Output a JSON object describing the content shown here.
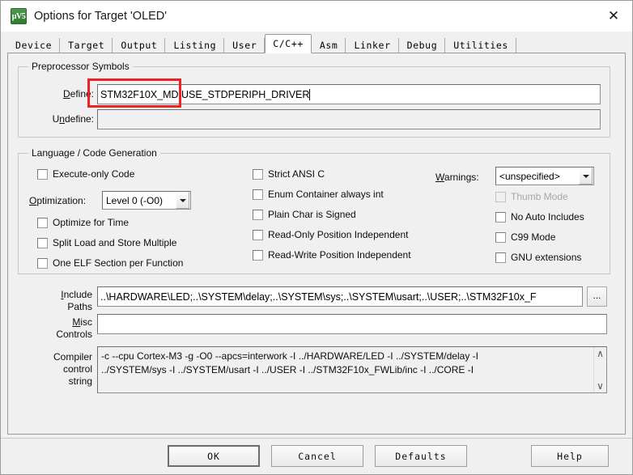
{
  "window": {
    "title": "Options for Target 'OLED'",
    "icon_name": "keil-uvision-icon",
    "icon_glyph": "µV5",
    "close_label": "✕"
  },
  "tabs": [
    {
      "label": "Device",
      "active": false
    },
    {
      "label": "Target",
      "active": false
    },
    {
      "label": "Output",
      "active": false
    },
    {
      "label": "Listing",
      "active": false
    },
    {
      "label": "User",
      "active": false
    },
    {
      "label": "C/C++",
      "active": true
    },
    {
      "label": "Asm",
      "active": false
    },
    {
      "label": "Linker",
      "active": false
    },
    {
      "label": "Debug",
      "active": false
    },
    {
      "label": "Utilities",
      "active": false
    }
  ],
  "preprocessor": {
    "group_title": "Preprocessor Symbols",
    "define_label": "Define:",
    "define_value": "STM32F10X_MD,USE_STDPERIPH_DRIVER",
    "undefine_label": "Undefine:",
    "undefine_value": ""
  },
  "language": {
    "group_title": "Language / Code Generation",
    "col1": [
      {
        "label": "Execute-only Code",
        "checked": false,
        "disabled": false
      },
      {
        "label": "Optimize for Time",
        "checked": false,
        "disabled": false
      },
      {
        "label": "Split Load and Store Multiple",
        "checked": false,
        "disabled": false
      },
      {
        "label": "One ELF Section per Function",
        "checked": false,
        "disabled": false
      }
    ],
    "col2": [
      {
        "label": "Strict ANSI C",
        "checked": false,
        "disabled": false
      },
      {
        "label": "Enum Container always int",
        "checked": false,
        "disabled": false
      },
      {
        "label": "Plain Char is Signed",
        "checked": false,
        "disabled": false
      },
      {
        "label": "Read-Only Position Independent",
        "checked": false,
        "disabled": false
      },
      {
        "label": "Read-Write Position Independent",
        "checked": false,
        "disabled": false
      }
    ],
    "col3": [
      {
        "label": "Thumb Mode",
        "checked": false,
        "disabled": true
      },
      {
        "label": "No Auto Includes",
        "checked": false,
        "disabled": false
      },
      {
        "label": "C99 Mode",
        "checked": false,
        "disabled": false
      },
      {
        "label": "GNU extensions",
        "checked": false,
        "disabled": false
      }
    ],
    "optimization_label": "Optimization:",
    "optimization_value": "Level 0 (-O0)",
    "warnings_label": "Warnings:",
    "warnings_value": "<unspecified>"
  },
  "paths": {
    "include_label_line1": "Include",
    "include_label_line2": "Paths",
    "include_value": "..\\HARDWARE\\LED;..\\SYSTEM\\delay;..\\SYSTEM\\sys;..\\SYSTEM\\usart;..\\USER;..\\STM32F10x_F",
    "browse_label": "...",
    "misc_label_line1": "Misc",
    "misc_label_line2": "Controls",
    "misc_value": ""
  },
  "compiler": {
    "label_line1": "Compiler",
    "label_line2": "control",
    "label_line3": "string",
    "value_line1": "-c --cpu Cortex-M3 -g -O0 --apcs=interwork -I ../HARDWARE/LED -I ../SYSTEM/delay -I",
    "value_line2": "../SYSTEM/sys -I ../SYSTEM/usart -I ../USER -I ../STM32F10x_FWLib/inc -I ../CORE -I",
    "scroll_up": "∧",
    "scroll_down": "∨"
  },
  "buttons": {
    "ok": "OK",
    "cancel": "Cancel",
    "defaults": "Defaults",
    "help": "Help"
  },
  "annotation": {
    "color": "#ee2222",
    "highlights": "define-field-symbol"
  }
}
